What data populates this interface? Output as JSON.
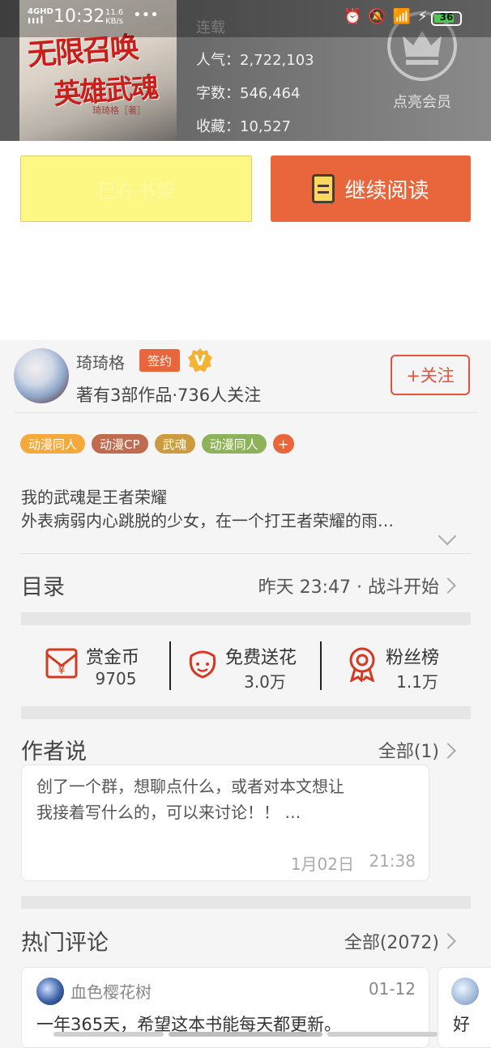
{
  "book": {
    "cover_title_line1": "无限召唤",
    "cover_title_line2": "英雄武魂",
    "cover_author": "琦琦格［著］",
    "status": "连载",
    "popularity": "人气：2,722,103",
    "word_count": "字数：546,464",
    "favorites": "收藏：10,527",
    "vip_label": "点亮会员"
  },
  "status_bar": {
    "network": "4GHD",
    "signal": "ıııl",
    "time": "10:32",
    "speed_value": "11.6",
    "speed_unit": "KB/s",
    "dots": "•••",
    "icons": "⏰🔕📶⚡",
    "battery": "36"
  },
  "actions": {
    "shelf_label": "已在书架",
    "read_label": "继续阅读"
  },
  "author": {
    "name": "琦琦格",
    "sign_badge": "签约",
    "v_badge": "V",
    "summary": "著有3部作品·736人关注",
    "follow_label": "+关注"
  },
  "tags": [
    {
      "label": "动漫同人",
      "color": "#f5a93b"
    },
    {
      "label": "动漫CP",
      "color": "#c06a4f"
    },
    {
      "label": "武魂",
      "color": "#cc9a3f"
    },
    {
      "label": "动漫同人",
      "color": "#8db25a"
    }
  ],
  "tag_more": "+",
  "intro": {
    "line1": "我的武魂是王者荣耀",
    "line2": "外表病弱内心跳脱的少女，在一个打王者荣耀的雨…"
  },
  "toc": {
    "title": "目录",
    "latest": "昨天 23:47 · 战斗开始"
  },
  "stats": [
    {
      "label": "赏金币",
      "value": "9705",
      "icon": "envelope-yen-icon"
    },
    {
      "label": "免费送花",
      "value": "3.0万",
      "icon": "flower-icon"
    },
    {
      "label": "粉丝榜",
      "value": "1.1万",
      "icon": "medal-icon"
    }
  ],
  "author_says": {
    "title": "作者说",
    "all_label": "全部(1)",
    "line1": "创了一个群，想聊点什么，或者对本文想让",
    "line2": "我接着写什么的，可以来讨论！！ …",
    "date": "1月02日",
    "time": "21:38"
  },
  "comments": {
    "title": "热门评论",
    "all_label": "全部(2072)",
    "first": {
      "user": "血色樱花树",
      "date": "01-12",
      "text": "一年365天，希望这本书能每天都更新。"
    },
    "second_preview": "好"
  },
  "colors": {
    "accent": "#e9653c",
    "shelf_button": "#fdf784"
  }
}
